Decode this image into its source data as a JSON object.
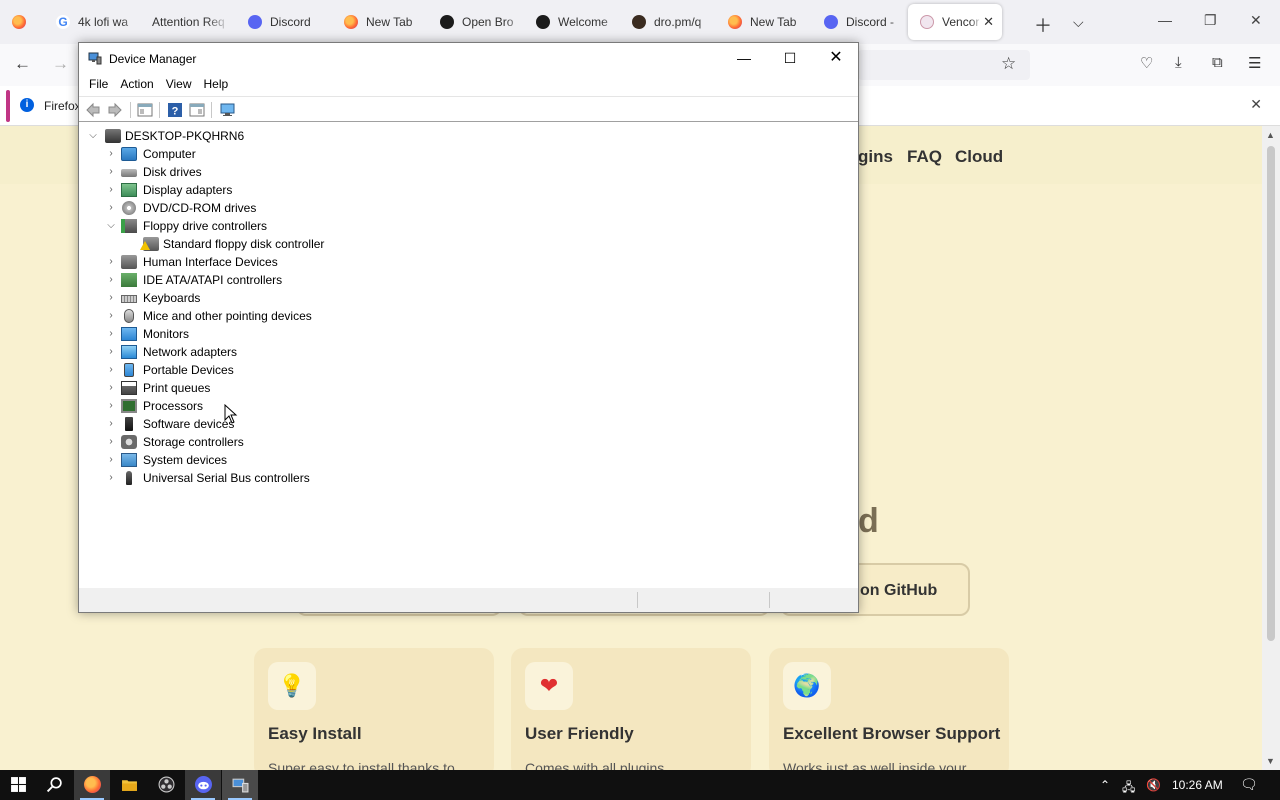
{
  "browser": {
    "tabs": [
      {
        "title": "",
        "icon": "firefox-icon"
      },
      {
        "title": "4k lofi wa",
        "icon": "google-icon"
      },
      {
        "title": "Attention Req",
        "icon": "none"
      },
      {
        "title": "Discord",
        "icon": "discord-icon"
      },
      {
        "title": "New Tab",
        "icon": "firefox-icon"
      },
      {
        "title": "Open Bro",
        "icon": "obs-icon"
      },
      {
        "title": "Welcome",
        "icon": "obs-icon"
      },
      {
        "title": "dro.pm/q",
        "icon": "dro-icon"
      },
      {
        "title": "New Tab",
        "icon": "firefox-icon"
      },
      {
        "title": "Discord -",
        "icon": "discord-icon"
      },
      {
        "title": "Vencor",
        "icon": "vencord-icon",
        "active": true
      }
    ],
    "notice_text": "Firefox",
    "accent_color": "#c03585"
  },
  "website": {
    "nav": [
      "gins",
      "FAQ",
      "Cloud"
    ],
    "hero_fragment": "d",
    "github_button": "on GitHub",
    "features": [
      {
        "title": "Easy Install",
        "text": "Super easy to install thanks to",
        "icon": "lightbulb-icon"
      },
      {
        "title": "User Friendly",
        "text": "Comes with all plugins",
        "icon": "heart-icon"
      },
      {
        "title": "Excellent Browser Support",
        "text": "Works just as well inside your",
        "icon": "globe-icon"
      }
    ]
  },
  "device_manager": {
    "title": "Device Manager",
    "menu": [
      "File",
      "Action",
      "View",
      "Help"
    ],
    "root": "DESKTOP-PKQHRN6",
    "categories": [
      {
        "label": "Computer",
        "icon": "computer-icon",
        "expanded": false
      },
      {
        "label": "Disk drives",
        "icon": "disk-drive-icon",
        "expanded": false
      },
      {
        "label": "Display adapters",
        "icon": "display-adapter-icon",
        "expanded": false
      },
      {
        "label": "DVD/CD-ROM drives",
        "icon": "dvd-drive-icon",
        "expanded": false
      },
      {
        "label": "Floppy drive controllers",
        "icon": "floppy-controller-icon",
        "expanded": true
      },
      {
        "label": "Standard floppy disk controller",
        "icon": "warning-device-icon",
        "child": true
      },
      {
        "label": "Human Interface Devices",
        "icon": "hid-icon",
        "expanded": false
      },
      {
        "label": "IDE ATA/ATAPI controllers",
        "icon": "ide-controller-icon",
        "expanded": false
      },
      {
        "label": "Keyboards",
        "icon": "keyboard-icon",
        "expanded": false
      },
      {
        "label": "Mice and other pointing devices",
        "icon": "mouse-icon",
        "expanded": false
      },
      {
        "label": "Monitors",
        "icon": "monitor-icon",
        "expanded": false
      },
      {
        "label": "Network adapters",
        "icon": "network-adapter-icon",
        "expanded": false
      },
      {
        "label": "Portable Devices",
        "icon": "portable-device-icon",
        "expanded": false
      },
      {
        "label": "Print queues",
        "icon": "printer-icon",
        "expanded": false
      },
      {
        "label": "Processors",
        "icon": "processor-icon",
        "expanded": false
      },
      {
        "label": "Software devices",
        "icon": "software-device-icon",
        "expanded": false
      },
      {
        "label": "Storage controllers",
        "icon": "storage-controller-icon",
        "expanded": false
      },
      {
        "label": "System devices",
        "icon": "system-device-icon",
        "expanded": false
      },
      {
        "label": "Universal Serial Bus controllers",
        "icon": "usb-icon",
        "expanded": false
      }
    ]
  },
  "taskbar": {
    "time": "10:26 AM",
    "apps": [
      "windows-start-icon",
      "search-icon",
      "firefox-icon",
      "file-explorer-icon",
      "obs-icon",
      "discord-icon",
      "device-manager-icon"
    ]
  }
}
